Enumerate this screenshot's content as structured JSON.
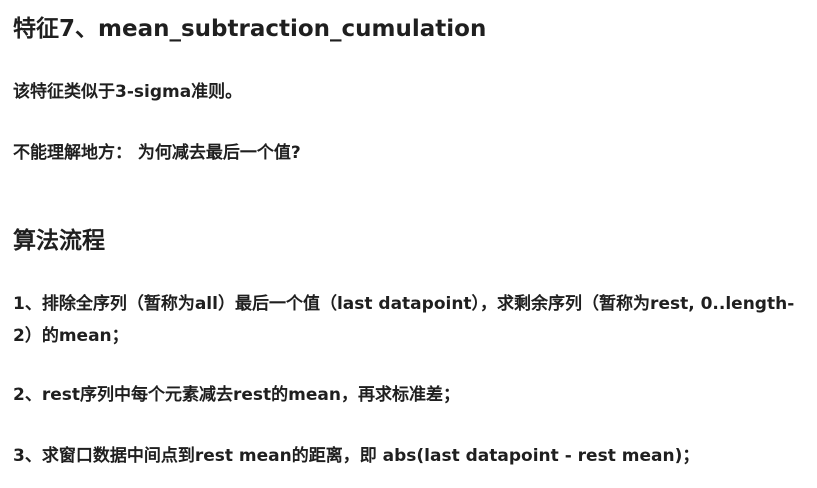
{
  "section1": {
    "title": "特征7、mean_subtraction_cumulation",
    "intro": "该特征类似于3-sigma准则。",
    "question": "不能理解地方： 为何减去最后一个值?"
  },
  "section2": {
    "title": "算法流程",
    "steps": [
      "1、排除全序列（暂称为all）最后一个值（last datapoint），求剩余序列（暂称为rest, 0..length-2）的mean；",
      "2、rest序列中每个元素减去rest的mean，再求标准差；",
      "3、求窗口数据中间点到rest mean的距离，即 abs(last datapoint - rest mean)；"
    ]
  }
}
